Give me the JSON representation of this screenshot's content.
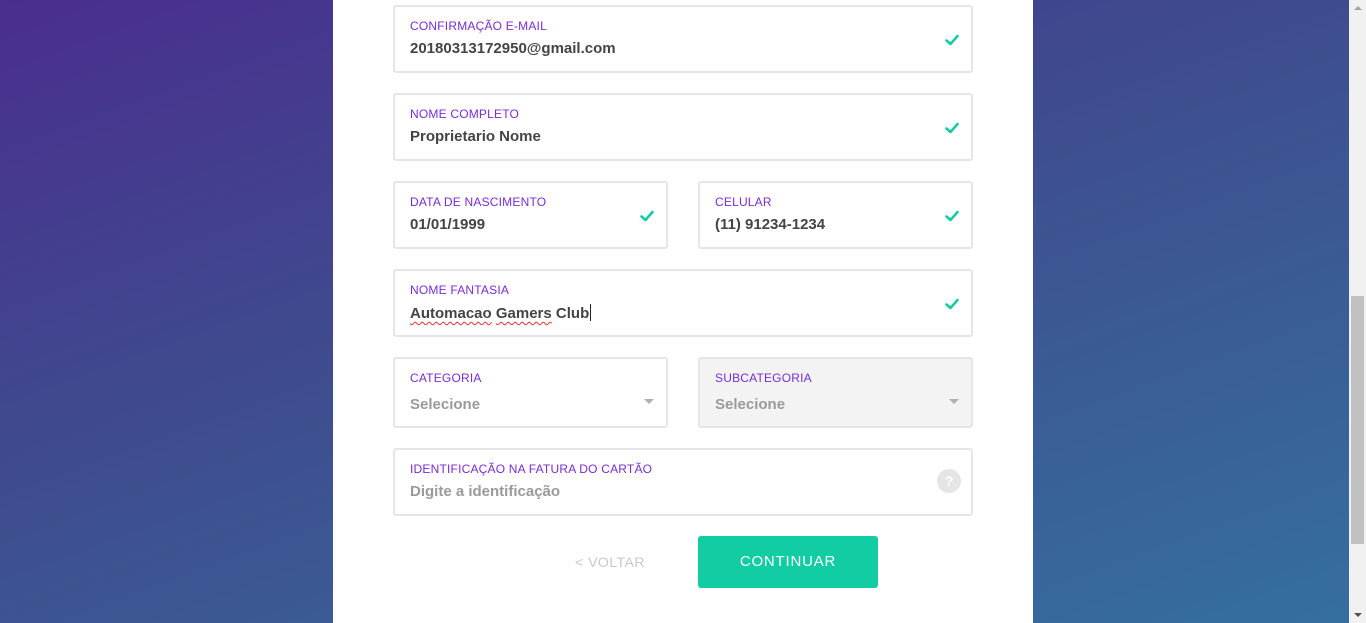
{
  "form": {
    "email_confirm": {
      "label": "CONFIRMAÇÃO E-MAIL",
      "value": "20180313172950@gmail.com",
      "valid": true
    },
    "full_name": {
      "label": "NOME COMPLETO",
      "value": "Proprietario Nome",
      "valid": true
    },
    "birth_date": {
      "label": "DATA DE NASCIMENTO",
      "value": "01/01/1999",
      "valid": true
    },
    "mobile": {
      "label": "CELULAR",
      "value": "(11) 91234-1234",
      "valid": true
    },
    "trade_name": {
      "label": "NOME FANTASIA",
      "value_words": [
        "Automacao",
        "Gamers",
        "Club"
      ],
      "valid": true
    },
    "category": {
      "label": "CATEGORIA",
      "placeholder": "Selecione"
    },
    "subcategory": {
      "label": "SUBCATEGORIA",
      "placeholder": "Selecione"
    },
    "card_id": {
      "label": "IDENTIFICAÇÃO NA FATURA DO CARTÃO",
      "placeholder": "Digite a identificação",
      "help": "?"
    }
  },
  "actions": {
    "back_label": "< VOLTAR",
    "continue_label": "CONTINUAR"
  },
  "icons": {
    "valid": "check-icon",
    "dropdown": "chevron-down-icon",
    "help": "question-icon"
  },
  "colors": {
    "label": "#7a2bd6",
    "check": "#12cda3",
    "primary_button": "#12cda3"
  }
}
